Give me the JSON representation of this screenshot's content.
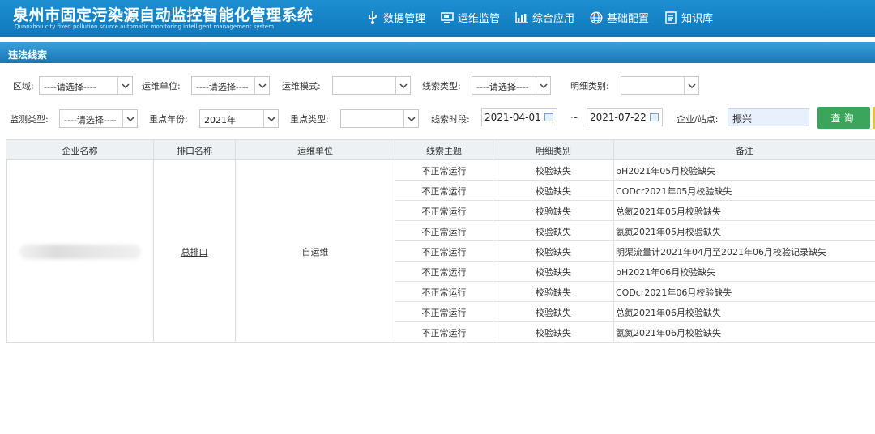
{
  "header": {
    "title_cn": "泉州市固定污染源自动监控智能化管理系统",
    "title_en": "Quanzhou city fixed pollution source automatic monitoring intelligent management system",
    "nav": [
      {
        "label": "数据管理",
        "icon": "usb-icon"
      },
      {
        "label": "运维监管",
        "icon": "monitor-icon"
      },
      {
        "label": "综合应用",
        "icon": "bar-chart-icon"
      },
      {
        "label": "基础配置",
        "icon": "globe-icon"
      },
      {
        "label": "知识库",
        "icon": "book-icon"
      }
    ]
  },
  "breadcrumb": "违法线索",
  "filters": {
    "region_label": "区域:",
    "region_value": "----请选择----",
    "ops_unit_label": "运维单位:",
    "ops_unit_value": "----请选择----",
    "ops_mode_label": "运维模式:",
    "ops_mode_value": "",
    "clue_type_label": "线索类型:",
    "clue_type_value": "----请选择----",
    "detail_type_label": "明细类别:",
    "detail_type_value": "",
    "monitor_type_label": "监测类型:",
    "monitor_type_value": "----请选择----",
    "key_year_label": "重点年份:",
    "key_year_value": "2021年",
    "key_type_label": "重点类型:",
    "key_type_value": "",
    "clue_period_label": "线索时段:",
    "date_from": "2021-04-01",
    "date_sep": "~",
    "date_to": "2021-07-22",
    "site_label": "企业/站点:",
    "site_value": "振兴",
    "query_button": "查询"
  },
  "table": {
    "headers": [
      "企业名称",
      "排口名称",
      "运维单位",
      "线索主题",
      "明细类别",
      "备注"
    ],
    "company": "",
    "outlet": "总排口",
    "ops_unit": "自运维",
    "rows": [
      {
        "topic": "不正常运行",
        "category": "校验缺失",
        "note": "pH2021年05月校验缺失"
      },
      {
        "topic": "不正常运行",
        "category": "校验缺失",
        "note": "CODcr2021年05月校验缺失"
      },
      {
        "topic": "不正常运行",
        "category": "校验缺失",
        "note": "总氮2021年05月校验缺失"
      },
      {
        "topic": "不正常运行",
        "category": "校验缺失",
        "note": "氨氮2021年05月校验缺失"
      },
      {
        "topic": "不正常运行",
        "category": "校验缺失",
        "note": "明渠流量计2021年04月至2021年06月校验记录缺失"
      },
      {
        "topic": "不正常运行",
        "category": "校验缺失",
        "note": "pH2021年06月校验缺失"
      },
      {
        "topic": "不正常运行",
        "category": "校验缺失",
        "note": "CODcr2021年06月校验缺失"
      },
      {
        "topic": "不正常运行",
        "category": "校验缺失",
        "note": "总氮2021年06月校验缺失"
      },
      {
        "topic": "不正常运行",
        "category": "校验缺失",
        "note": "氨氮2021年06月校验缺失"
      }
    ]
  }
}
